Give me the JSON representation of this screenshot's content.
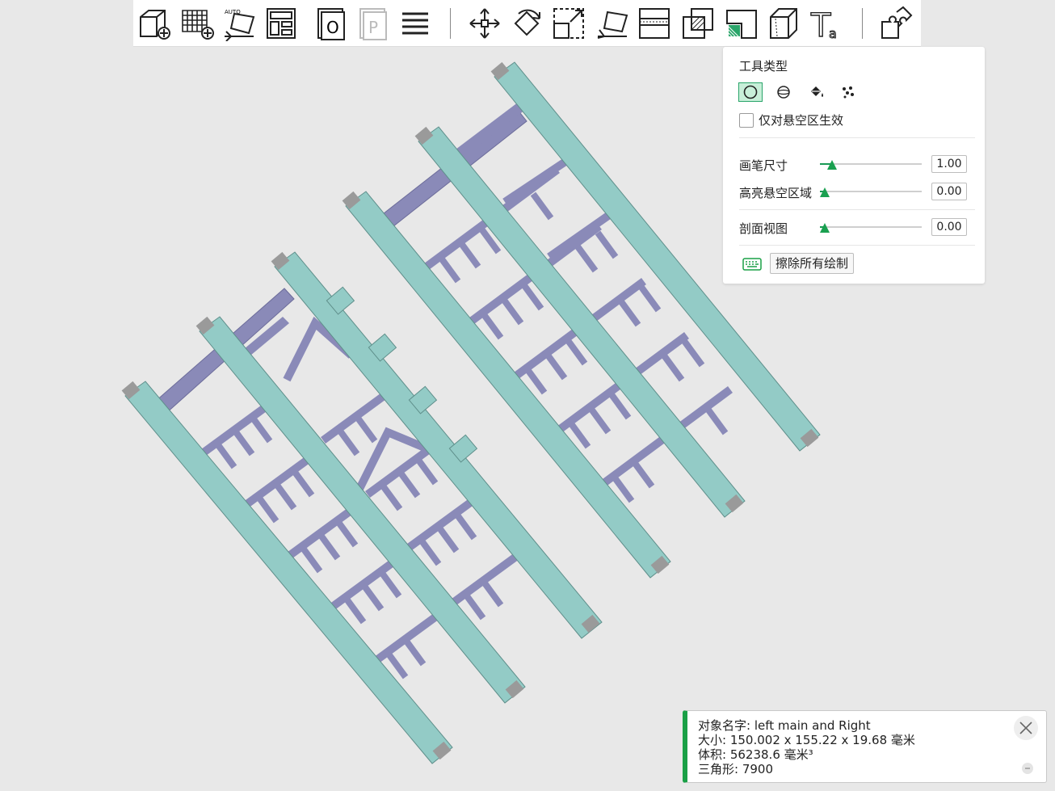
{
  "toolbar": {
    "tools": [
      {
        "name": "add-box-icon",
        "label": ""
      },
      {
        "name": "add-grid-icon",
        "label": ""
      },
      {
        "name": "auto-orient-icon",
        "label": "AUTO"
      },
      {
        "name": "layout-icon",
        "label": ""
      },
      {
        "name": "object-o-icon",
        "label": "O"
      },
      {
        "name": "object-p-icon",
        "label": "P"
      },
      {
        "name": "list-lines-icon",
        "label": ""
      },
      {
        "name": "move-icon",
        "label": ""
      },
      {
        "name": "rotate-icon",
        "label": ""
      },
      {
        "name": "scale-icon",
        "label": ""
      },
      {
        "name": "place-on-face-icon",
        "label": ""
      },
      {
        "name": "cut-icon",
        "label": ""
      },
      {
        "name": "boolean-icon",
        "label": ""
      },
      {
        "name": "support-paint-icon",
        "label": ""
      },
      {
        "name": "seam-icon",
        "label": ""
      },
      {
        "name": "text-icon",
        "label": "T",
        "sub": "a"
      },
      {
        "name": "assembly-icon",
        "label": ""
      }
    ]
  },
  "panel": {
    "title": "工具类型",
    "tool_types": [
      {
        "name": "circle-tool-icon",
        "selected": true
      },
      {
        "name": "sphere-tool-icon",
        "selected": false
      },
      {
        "name": "fill-bucket-icon",
        "selected": false
      },
      {
        "name": "gap-fill-icon",
        "selected": false
      }
    ],
    "overhang_only_label": "仅对悬空区生效",
    "overhang_only_checked": false,
    "sliders": [
      {
        "label": "画笔尺寸",
        "value": "1.00",
        "fraction": 0.12
      },
      {
        "label": "高亮悬空区域",
        "value": "0.00",
        "fraction": 0.05
      },
      {
        "label": "剖面视图",
        "value": "0.00",
        "fraction": 0.05
      }
    ],
    "erase_all_label": "擦除所有绘制"
  },
  "info": {
    "name_label": "对象名字:",
    "name_value": "left main and Right",
    "size_label": "大小:",
    "size_value": "150.002 x 155.22 x 19.68 毫米",
    "volume_label": "体积:",
    "volume_value": "56238.6 毫米³",
    "triangles_label": "三角形:",
    "triangles_value": "7900"
  },
  "colors": {
    "background": "#e8e8e8",
    "rail": "#93cbc6",
    "rung": "#8a8ab8",
    "accent": "#1aa046"
  }
}
